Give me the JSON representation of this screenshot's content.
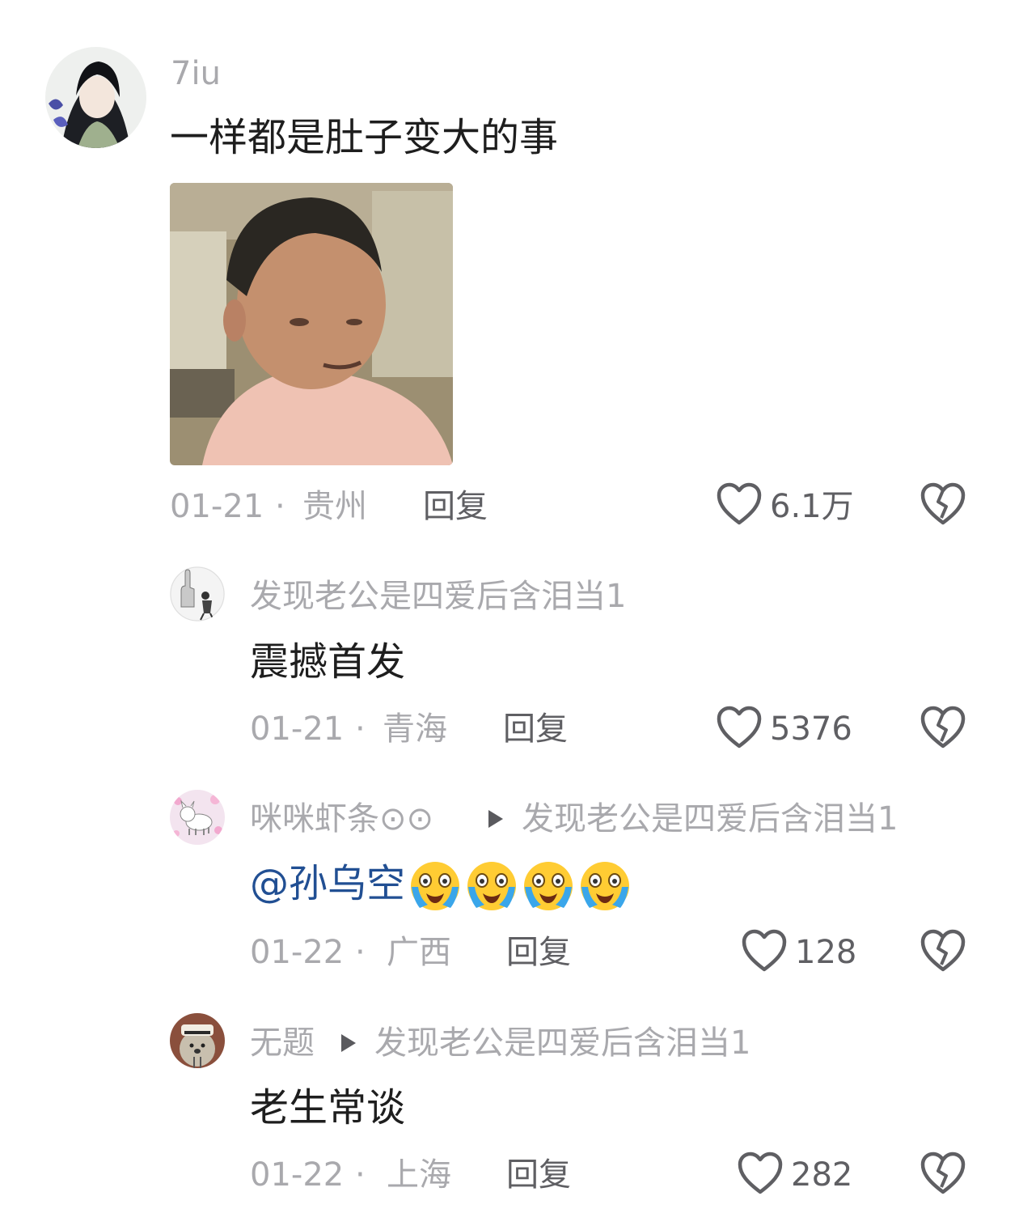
{
  "comments": [
    {
      "username": "7iu",
      "text": "一样都是肚子变大的事",
      "date": "01-21",
      "separator": "·",
      "location": "贵州",
      "reply_label": "回复",
      "likes": "6.1万"
    },
    {
      "username": "发现老公是四爱后含泪当1",
      "text": "震撼首发",
      "date": "01-21",
      "separator": "·",
      "location": "青海",
      "reply_label": "回复",
      "likes": "5376"
    },
    {
      "username": "咪咪虾条⊙⊙",
      "reply_to": "发现老公是四爱后含泪当1",
      "mention": "@孙乌空",
      "emojis": [
        "crying-face",
        "crying-face",
        "crying-face",
        "crying-face"
      ],
      "date": "01-22",
      "separator": "·",
      "location": "广西",
      "reply_label": "回复",
      "likes": "128"
    },
    {
      "username": "无题",
      "reply_to": "发现老公是四爱后含泪当1",
      "text": "老生常谈",
      "date": "01-22",
      "separator": "·",
      "location": "上海",
      "reply_label": "回复",
      "likes": "282"
    }
  ],
  "icons": {
    "like": "heart-outline-icon",
    "dislike": "broken-heart-icon",
    "reply_arrow": "triangle-right-icon"
  },
  "colors": {
    "username": "#a9a9ad",
    "text": "#1e1e1e",
    "mention": "#214f93",
    "secondary": "#5f5f63"
  }
}
